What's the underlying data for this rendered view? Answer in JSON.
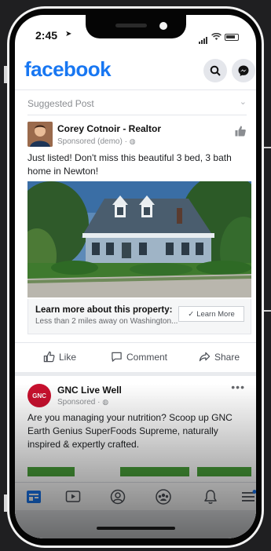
{
  "status_bar": {
    "time": "2:45"
  },
  "header": {
    "logo": "facebook"
  },
  "suggested_post": {
    "section_label": "Suggested Post",
    "author": "Corey Cotnoir - Realtor",
    "meta": "Sponsored (demo) ·",
    "text": "Just listed! Don't miss this beautiful 3 bed, 3 bath home in Newton!",
    "cta": {
      "title": "Learn more about this property:",
      "subtitle": "Less than 2 miles away on Washington...",
      "button": "Learn More"
    }
  },
  "action_bar": {
    "like": "Like",
    "comment": "Comment",
    "share": "Share"
  },
  "gnc_post": {
    "logo_text": "GNC",
    "author": "GNC Live Well",
    "meta": "Sponsored ·",
    "text": "Are you managing your nutrition? Scoop up GNC Earth Genius SuperFoods Supreme, naturally inspired & expertly crafted."
  },
  "colors": {
    "facebook_blue": "#1877f2",
    "gnc_red": "#c8102e",
    "cta_green": "#4aa13a"
  },
  "tab_icons": [
    "news-feed-icon",
    "watch-icon",
    "profile-icon",
    "groups-icon",
    "notifications-icon",
    "menu-icon"
  ]
}
